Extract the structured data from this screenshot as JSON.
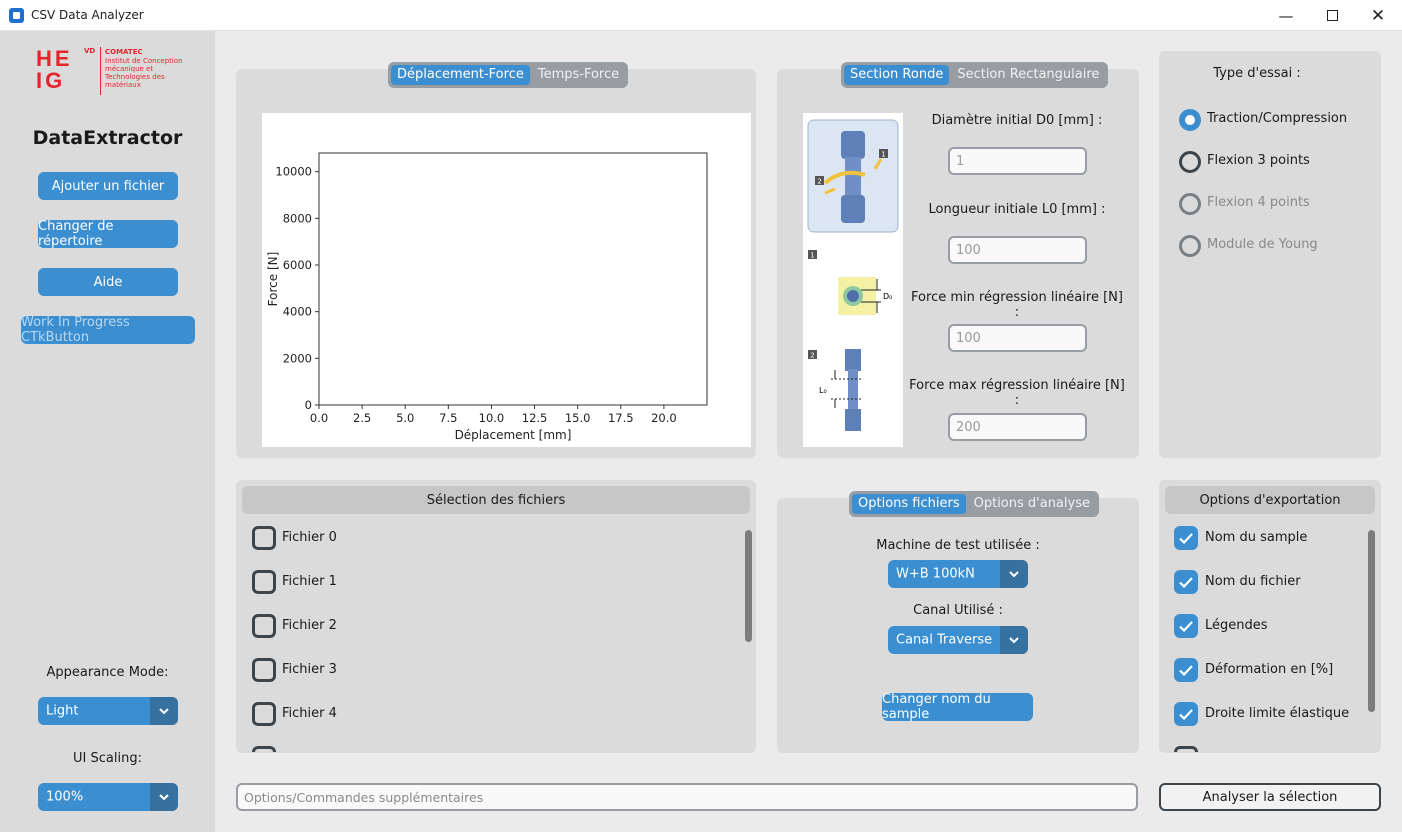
{
  "window": {
    "title": "CSV Data Analyzer"
  },
  "sidebar": {
    "logo_letters_top": "HE",
    "logo_letters_bottom": "IG",
    "logo_vd": "VD",
    "logo_org": "COMATEC",
    "logo_org_desc": [
      "Institut de Conception",
      "mécanique et",
      "Technologies des",
      "matériaux"
    ],
    "app_name": "DataExtractor",
    "buttons": [
      "Ajouter un fichier",
      "Changer de répertoire",
      "Aide",
      "Work In Progress CTkButton"
    ],
    "appearance_label": "Appearance Mode:",
    "appearance_value": "Light",
    "scaling_label": "UI Scaling:",
    "scaling_value": "100%"
  },
  "plot_panel": {
    "tabs": [
      "Déplacement-Force",
      "Temps-Force"
    ],
    "selected_tab": "Déplacement-Force"
  },
  "chart_data": {
    "type": "line",
    "title": "",
    "xlabel": "Déplacement [mm]",
    "ylabel": "Force [N]",
    "xlim": [
      0,
      22.5
    ],
    "ylim": [
      0,
      10800
    ],
    "xticks": [
      "0.0",
      "2.5",
      "5.0",
      "7.5",
      "10.0",
      "12.5",
      "15.0",
      "17.5",
      "20.0"
    ],
    "xtick_values": [
      0,
      2.5,
      5,
      7.5,
      10,
      12.5,
      15,
      17.5,
      20
    ],
    "yticks": [
      "0",
      "2000",
      "4000",
      "6000",
      "8000",
      "10000"
    ],
    "ytick_values": [
      0,
      2000,
      4000,
      6000,
      8000,
      10000
    ],
    "series": []
  },
  "section_panel": {
    "tabs": [
      "Section Ronde",
      "Section Rectangulaire"
    ],
    "selected_tab": "Section Ronde",
    "diagram_labels": {
      "badge1": "1",
      "badge2": "2",
      "d0": "D₀",
      "l0": "L₀"
    },
    "fields": [
      {
        "label": "Diamètre initial D0 [mm] :",
        "placeholder": "1"
      },
      {
        "label": "Longueur initiale L0 [mm] :",
        "placeholder": "100"
      },
      {
        "label": "Force min régression linéaire [N] :",
        "placeholder": "100"
      },
      {
        "label": "Force max régression linéaire [N] :",
        "placeholder": "200"
      }
    ]
  },
  "test_type": {
    "title": "Type d'essai :",
    "options": [
      {
        "label": "Traction/Compression",
        "selected": true,
        "disabled": false
      },
      {
        "label": "Flexion 3 points",
        "selected": false,
        "disabled": false
      },
      {
        "label": "Flexion 4 points",
        "selected": false,
        "disabled": true
      },
      {
        "label": "Module de Young",
        "selected": false,
        "disabled": true
      }
    ]
  },
  "file_selection": {
    "title": "Sélection des fichiers",
    "files": [
      "Fichier 0",
      "Fichier 1",
      "Fichier 2",
      "Fichier 3",
      "Fichier 4"
    ]
  },
  "options_panel": {
    "tabs": [
      "Options fichiers",
      "Options d'analyse"
    ],
    "selected_tab": "Options fichiers",
    "machine_label": "Machine de test utilisée :",
    "machine_value": "W+B 100kN",
    "channel_label": "Canal Utilisé :",
    "channel_value": "Canal Traverse",
    "rename_button": "Changer nom du sample"
  },
  "export_options": {
    "title": "Options d'exportation",
    "items": [
      {
        "label": "Nom du sample",
        "checked": true
      },
      {
        "label": "Nom du fichier",
        "checked": true
      },
      {
        "label": "Légendes",
        "checked": true
      },
      {
        "label": "Déformation en [%]",
        "checked": true
      },
      {
        "label": "Droite limite élastique",
        "checked": true
      }
    ]
  },
  "bottom": {
    "command_placeholder": "Options/Commandes supplémentaires",
    "analyze_button": "Analyser la sélection"
  },
  "colors": {
    "accent": "#3b8ed0",
    "accent_dark": "#36719f",
    "logo_red": "#e3262b",
    "frame": "#dbdbdb"
  }
}
